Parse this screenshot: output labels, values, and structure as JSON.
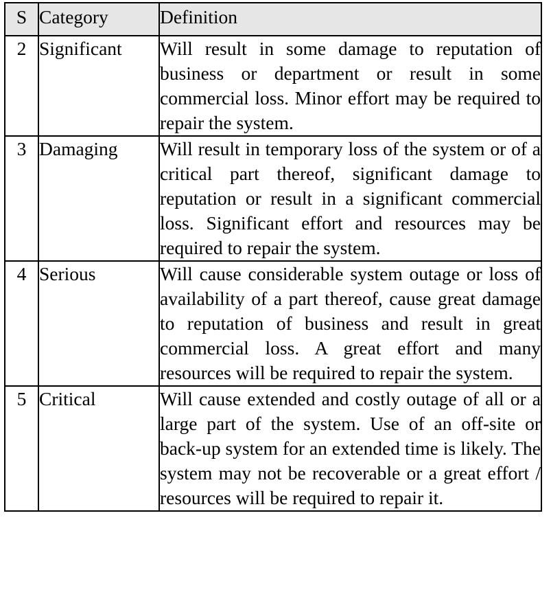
{
  "table": {
    "headers": {
      "s": "S",
      "category": "Category",
      "definition": "Definition"
    },
    "rows": [
      {
        "s": "2",
        "category": "Significant",
        "definition": "Will result in some damage to reputation of business or department or result in some commercial loss. Minor effort may be required to repair the system."
      },
      {
        "s": "3",
        "category": "Damaging",
        "definition": "Will result in temporary loss of the system or of a critical part thereof, significant damage to reputation or result in a significant commercial loss. Significant effort and resources may be required to repair the system."
      },
      {
        "s": "4",
        "category": "Serious",
        "definition": "Will cause considerable system outage or loss of availability of a part thereof, cause great damage to reputation of business and result in great commercial loss. A great effort and many resources will be required to repair the system."
      },
      {
        "s": "5",
        "category": "Critical",
        "definition": "Will cause extended and costly outage of all or a large part of the system. Use of an off-site or back-up system for an extended time is likely.  The system may not be recoverable or a great effort / resources will be required to repair it."
      }
    ]
  }
}
